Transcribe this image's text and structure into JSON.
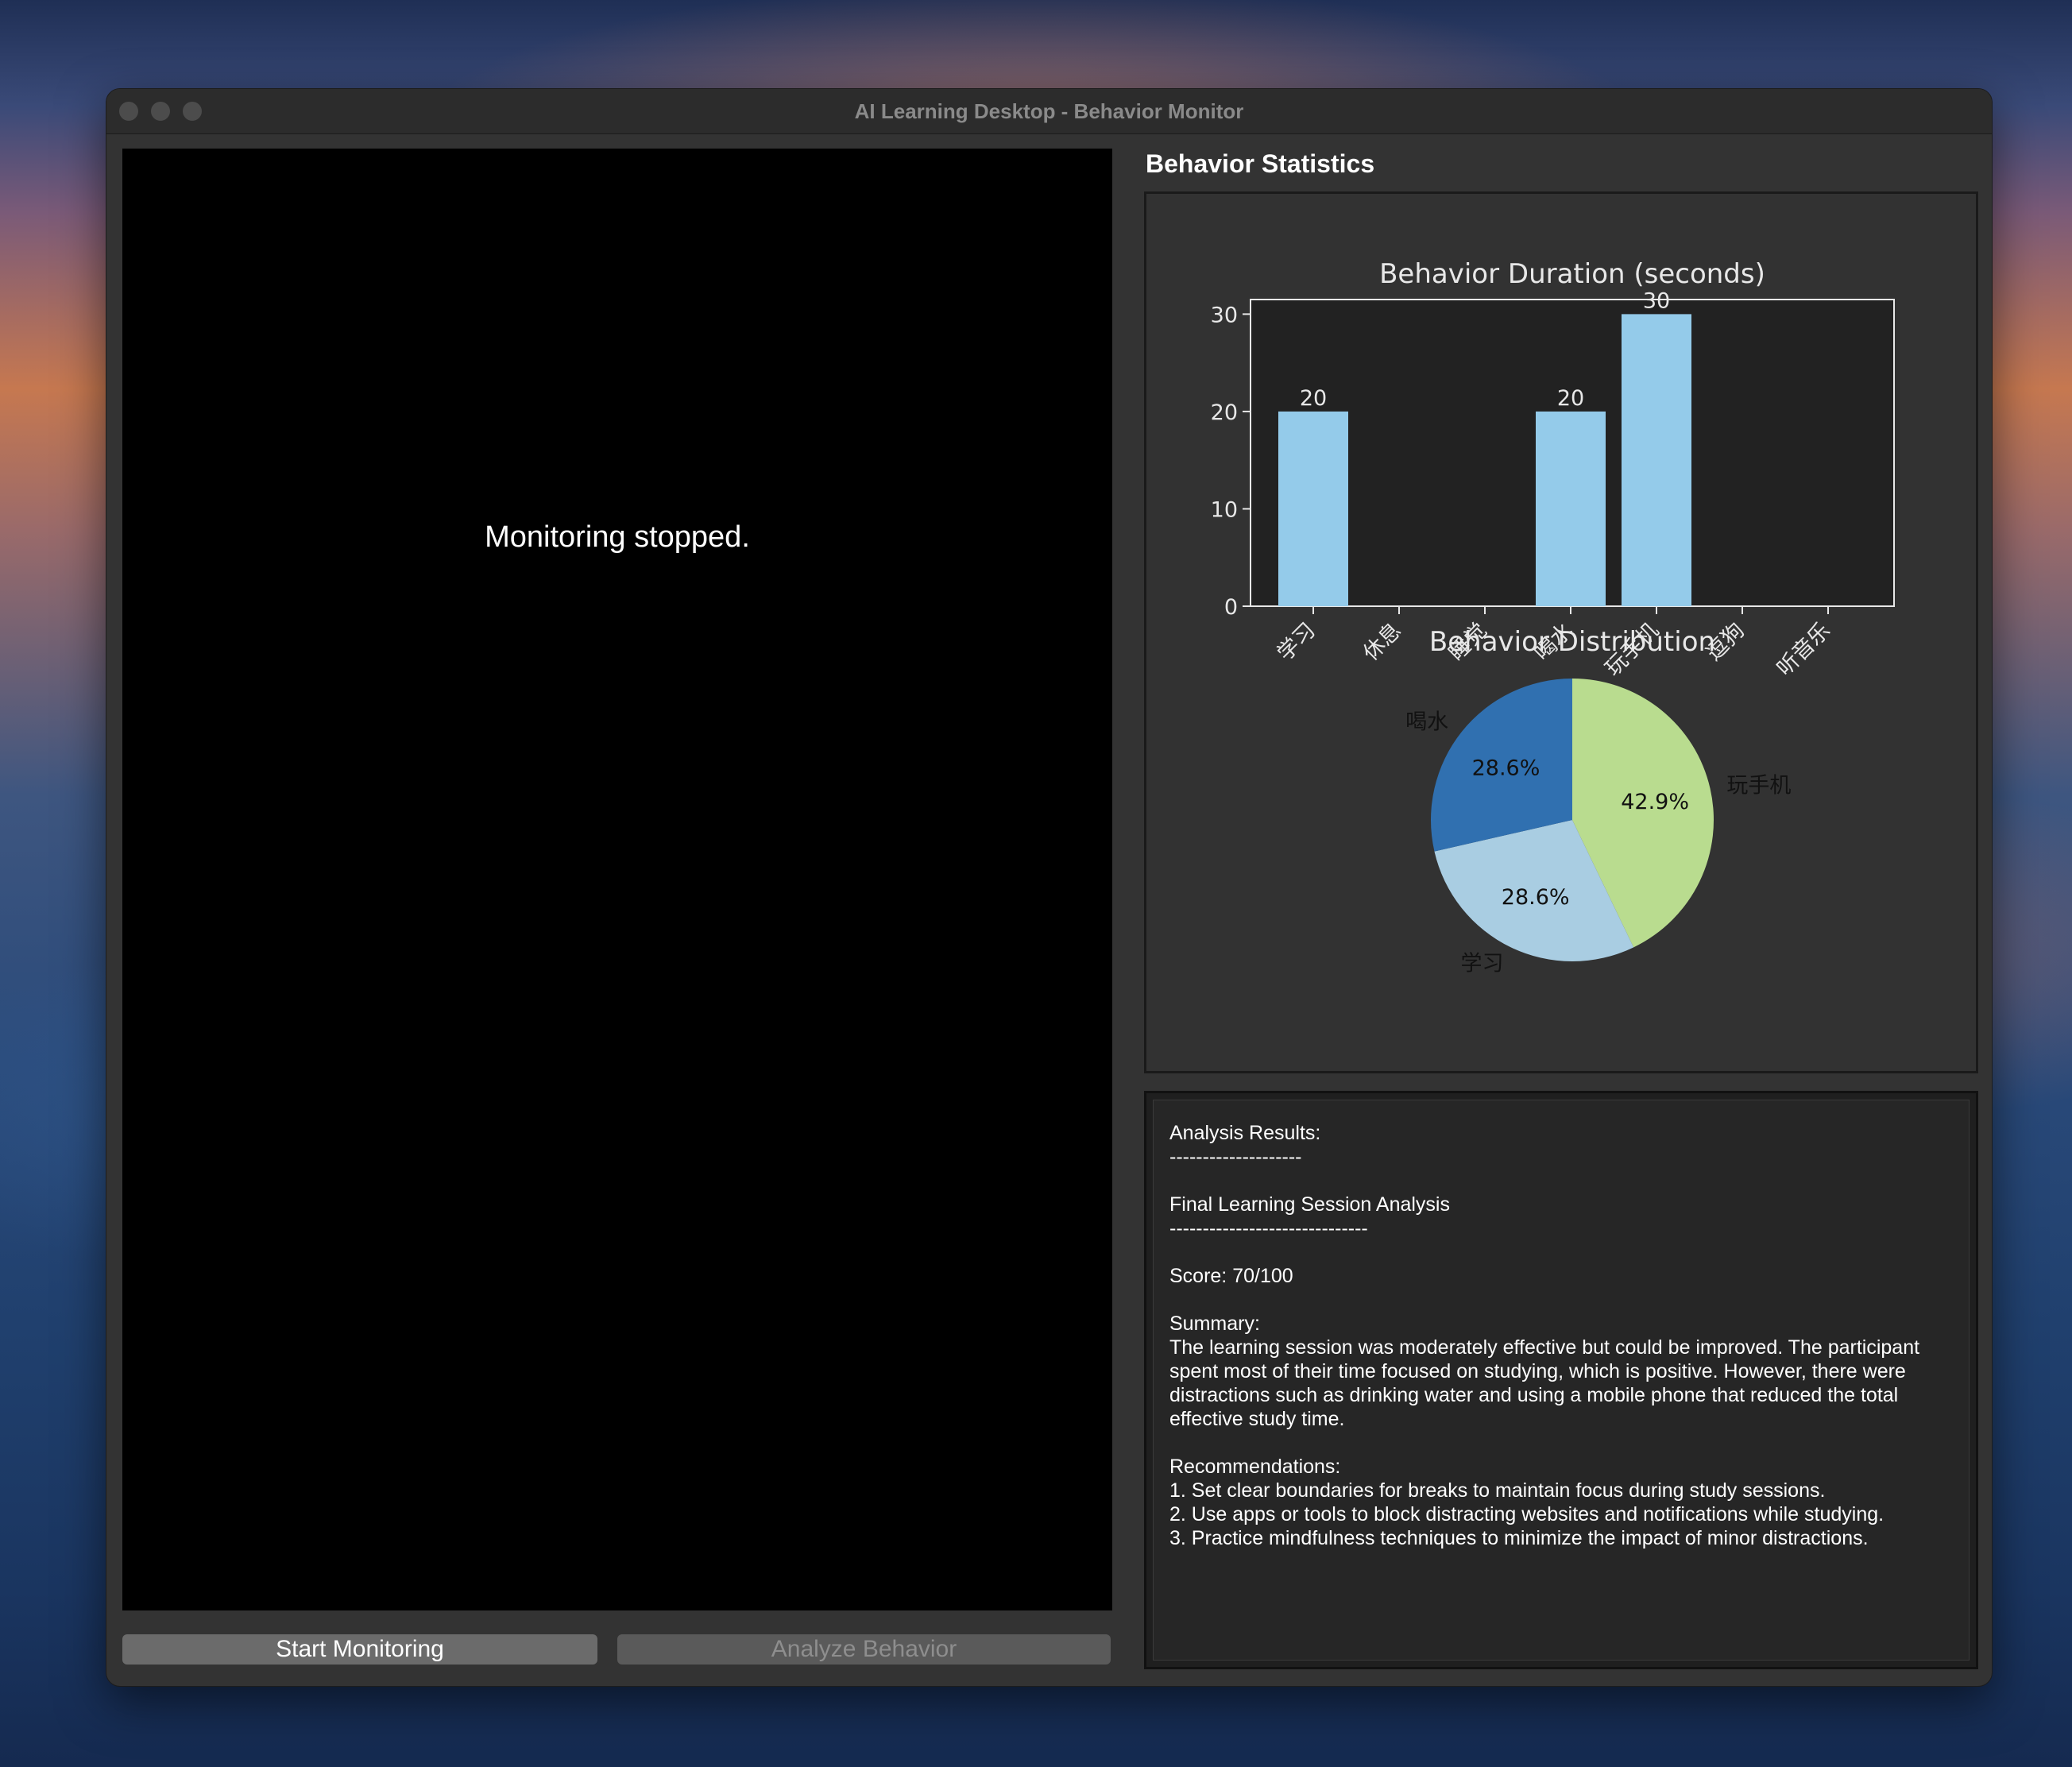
{
  "window": {
    "title": "AI Learning Desktop - Behavior Monitor"
  },
  "video": {
    "status_text": "Monitoring stopped."
  },
  "buttons": {
    "start_label": "Start Monitoring",
    "analyze_label": "Analyze Behavior"
  },
  "stats": {
    "heading": "Behavior Statistics"
  },
  "chart_data": [
    {
      "type": "bar",
      "title": "Behavior Duration (seconds)",
      "categories": [
        "学习",
        "休息",
        "睡觉",
        "喝水",
        "玩手机",
        "逗狗",
        "听音乐"
      ],
      "values": [
        20,
        0,
        0,
        20,
        30,
        0,
        0
      ],
      "data_labels": [
        "20",
        "",
        "",
        "20",
        "30",
        "",
        ""
      ],
      "ylim": [
        0,
        31.5
      ],
      "yticks": [
        0,
        10,
        20,
        30
      ],
      "bar_color": "#94cbea"
    },
    {
      "type": "pie",
      "title": "Behavior Distribution",
      "slices": [
        {
          "label": "玩手机",
          "value": 30,
          "pct_label": "42.9%",
          "color": "#b9dc8f"
        },
        {
          "label": "学习",
          "value": 20,
          "pct_label": "28.6%",
          "color": "#a9cde2"
        },
        {
          "label": "喝水",
          "value": 20,
          "pct_label": "28.6%",
          "color": "#3070b0"
        }
      ]
    }
  ],
  "results": {
    "text": "Analysis Results:\n--------------------\n\nFinal Learning Session Analysis\n------------------------------\n\nScore: 70/100\n\nSummary:\nThe learning session was moderately effective but could be improved. The participant spent most of their time focused on studying, which is positive. However, there were distractions such as drinking water and using a mobile phone that reduced the total effective study time.\n\nRecommendations:\n1. Set clear boundaries for breaks to maintain focus during study sessions.\n2. Use apps or tools to block distracting websites and notifications while studying.\n3. Practice mindfulness techniques to minimize the impact of minor distractions."
  },
  "colors": {
    "window_bg": "#333333",
    "chart_bg": "#222222",
    "bar": "#94cbea"
  }
}
